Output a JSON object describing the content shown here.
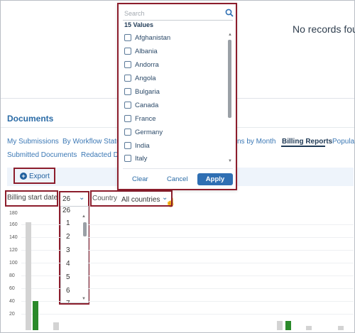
{
  "status": {
    "no_records": "No records fou"
  },
  "documents": {
    "title": "Documents"
  },
  "tabs": [
    {
      "label": "My Submissions"
    },
    {
      "label": "By Workflow Statu"
    },
    {
      "label": "ns by Month"
    },
    {
      "label": "Billing Reports",
      "active": true
    },
    {
      "label": "Popula"
    },
    {
      "label": "Submitted Documents"
    },
    {
      "label": "Redacted Do"
    }
  ],
  "toolbar": {
    "export_label": "Export",
    "export_icon": "plus-circle-icon"
  },
  "filters": {
    "billing_label": "Billing start date",
    "month_value": "26",
    "country_label": "Country",
    "country_value": "All countries"
  },
  "month_dropdown": {
    "options": [
      "26",
      "1",
      "2",
      "3",
      "4",
      "5",
      "6",
      "7"
    ]
  },
  "country_popup": {
    "search_placeholder": "Search",
    "count": "15 Values",
    "options": [
      "Afghanistan",
      "Albania",
      "Andorra",
      "Angola",
      "Bulgaria",
      "Canada",
      "France",
      "Germany",
      "India",
      "Italy"
    ],
    "clear": "Clear",
    "cancel": "Cancel",
    "apply": "Apply"
  },
  "chart": {
    "y_ticks": [
      "180",
      "160",
      "140",
      "120",
      "100",
      "80",
      "60",
      "40",
      "20"
    ]
  },
  "colors": {
    "accent": "#2f6fb3",
    "highlight": "#8c1d2c",
    "bar_green": "#2a8a2a",
    "bar_gray": "#d3d3d3"
  }
}
